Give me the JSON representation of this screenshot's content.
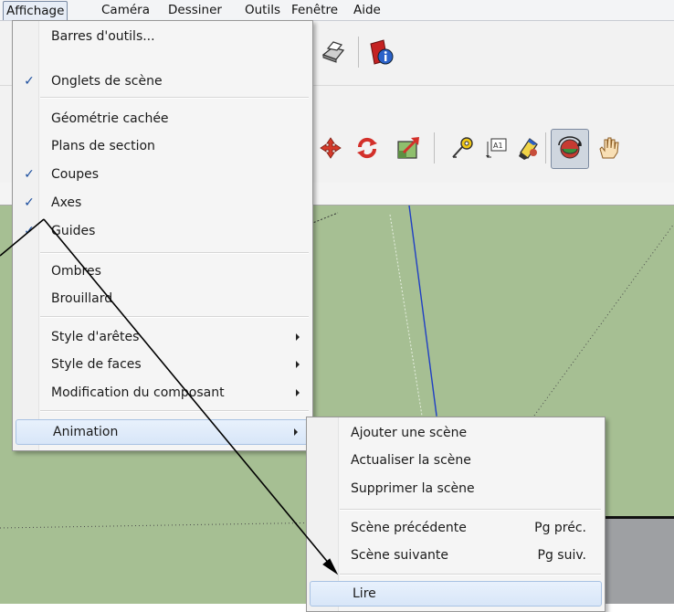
{
  "menubar": {
    "items": [
      "Affichage",
      "Caméra",
      "Dessiner",
      "Outils",
      "Fenêtre",
      "Aide"
    ]
  },
  "view_menu": {
    "items": [
      {
        "label": "Barres d'outils...",
        "checked": false
      },
      {
        "label": "Onglets de scène",
        "checked": true
      },
      {
        "label": "Géométrie cachée",
        "checked": false
      },
      {
        "label": "Plans de section",
        "checked": false
      },
      {
        "label": "Coupes",
        "checked": true
      },
      {
        "label": "Axes",
        "checked": true
      },
      {
        "label": "Guides",
        "checked": true
      },
      {
        "label": "Ombres",
        "checked": false
      },
      {
        "label": "Brouillard",
        "checked": false
      },
      {
        "label": "Style d'arêtes",
        "checked": false,
        "submenu": true
      },
      {
        "label": "Style de faces",
        "checked": false,
        "submenu": true
      },
      {
        "label": "Modification du composant",
        "checked": false,
        "submenu": true
      },
      {
        "label": "Animation",
        "checked": false,
        "submenu": true,
        "highlighted": true
      }
    ],
    "check_glyph": "✓"
  },
  "animation_submenu": {
    "items": [
      {
        "label": "Ajouter une scène",
        "shortcut": ""
      },
      {
        "label": "Actualiser la scène",
        "shortcut": ""
      },
      {
        "label": "Supprimer la scène",
        "shortcut": ""
      },
      {
        "label": "Scène précédente",
        "shortcut": "Pg préc."
      },
      {
        "label": "Scène suivante",
        "shortcut": "Pg suiv."
      },
      {
        "label": "Lire",
        "shortcut": "",
        "highlighted": true
      }
    ]
  },
  "toolbar": {
    "icons": [
      "print-icon",
      "model-info-icon",
      "move-icon",
      "rotate-icon",
      "scale-icon",
      "tape-measure-icon",
      "text-icon",
      "paint-bucket-icon",
      "orbit-icon",
      "pan-icon"
    ]
  },
  "colors": {
    "viewport": "#a6bf93",
    "highlight": "#d8e6f8",
    "check": "#1a4d9e",
    "axis_blue": "#1f3fc4"
  }
}
